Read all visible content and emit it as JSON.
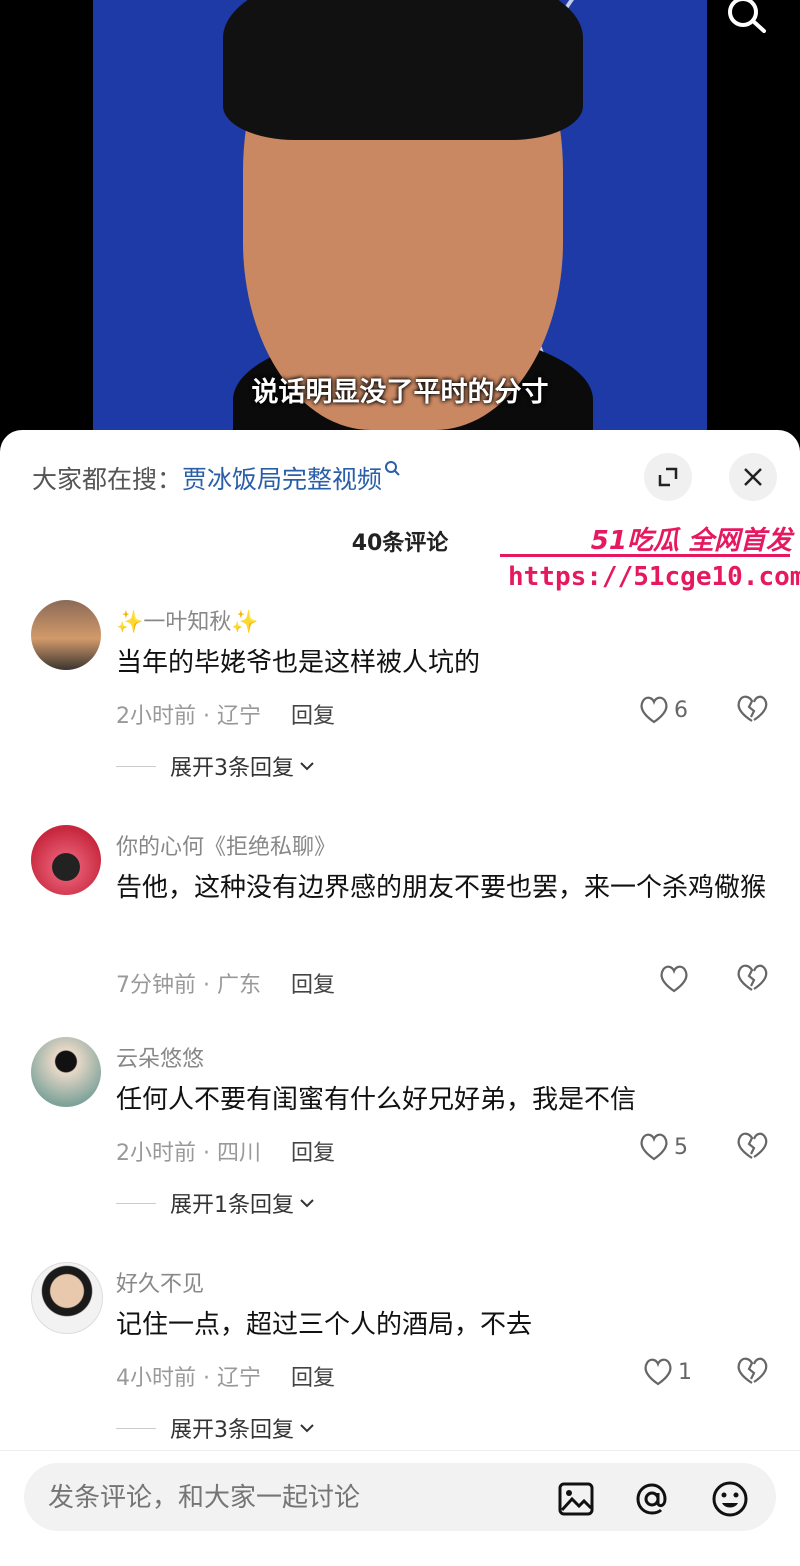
{
  "video": {
    "subtitle": "说话明显没了平时的分寸"
  },
  "panel": {
    "trending_prefix": "大家都在搜：",
    "trending_keyword": "贾冰饭局完整视频",
    "comment_count": "40条评论"
  },
  "watermark": {
    "title": "51吃瓜 全网首发",
    "url": "https://51cge10.com"
  },
  "comments": [
    {
      "name": "✨一叶知秋✨",
      "text": "当年的毕姥爷也是这样被人坑的",
      "meta": "2小时前 · 辽宁",
      "reply_label": "回复",
      "likes": "6",
      "expand": "展开3条回复"
    },
    {
      "name": "你的心何《拒绝私聊》",
      "text": "告他，这种没有边界感的朋友不要也罢，来一个杀鸡儆猴",
      "meta": "7分钟前 · 广东",
      "reply_label": "回复",
      "likes": "",
      "expand": ""
    },
    {
      "name": "云朵悠悠",
      "text": "任何人不要有闺蜜有什么好兄好弟，我是不信",
      "meta": "2小时前 · 四川",
      "reply_label": "回复",
      "likes": "5",
      "expand": "展开1条回复"
    },
    {
      "name": "好久不见",
      "text": "记住一点，超过三个人的酒局，不去",
      "meta": "4小时前 · 辽宁",
      "reply_label": "回复",
      "likes": "1",
      "expand": "展开3条回复"
    }
  ],
  "input": {
    "placeholder": "发条评论，和大家一起讨论"
  },
  "colors": {
    "accent": "#2a5fa8",
    "watermark": "#e6185f"
  }
}
